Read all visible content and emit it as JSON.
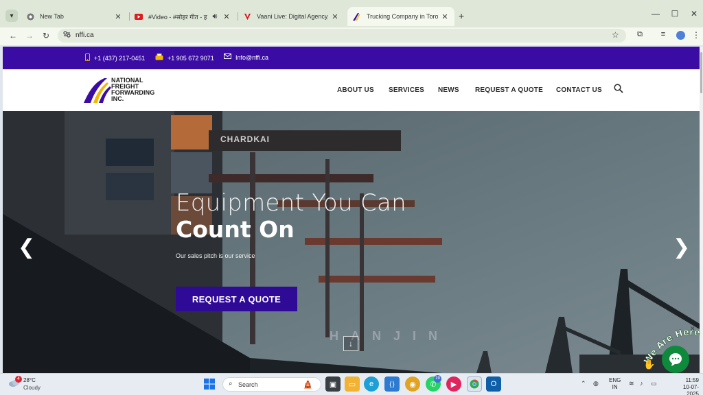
{
  "browser": {
    "tabs": [
      {
        "title": "New Tab",
        "icon": "chrome-icon"
      },
      {
        "title": "#Video - #सोहर गीत - हमरा",
        "icon": "youtube-icon",
        "audio": true
      },
      {
        "title": "Vaani Live: Digital Agency, Web",
        "icon": "vaani-icon"
      },
      {
        "title": "Trucking Company in Toronto |",
        "icon": "nffi-icon",
        "active": true
      }
    ],
    "url": "nffi.ca"
  },
  "site": {
    "topbar": {
      "phone1": "+1 (437) 217-0451",
      "phone2": "+1 905 672 9071",
      "email": "Info@nffi.ca"
    },
    "logo": {
      "line1": "NATIONAL",
      "line2": "FREIGHT",
      "line3": "FORWARDING",
      "line4": "INC."
    },
    "nav": [
      "ABOUT US",
      "SERVICES",
      "NEWS",
      "REQUEST A QUOTE",
      "CONTACT US"
    ],
    "hero": {
      "line1": "Equipment You Can",
      "line2": "Count On",
      "subtitle": "Our sales pitch is our service",
      "button": "REQUEST A QUOTE",
      "ship_text": "HANJIN",
      "crane_text": "CHARDKAI"
    },
    "chat_badge": "We Are Here!"
  },
  "taskbar": {
    "temperature": "28°C",
    "condition": "Cloudy",
    "weather_badge": "4",
    "search_label": "Search",
    "whatsapp_badge": "19",
    "lang_line1": "ENG",
    "lang_line2": "IN",
    "time": "11:59",
    "date": "10-07-2025"
  },
  "colors": {
    "brand_purple": "#3a0ca3",
    "button_purple": "#2f0a96",
    "chat_green": "#0f8a3c"
  }
}
